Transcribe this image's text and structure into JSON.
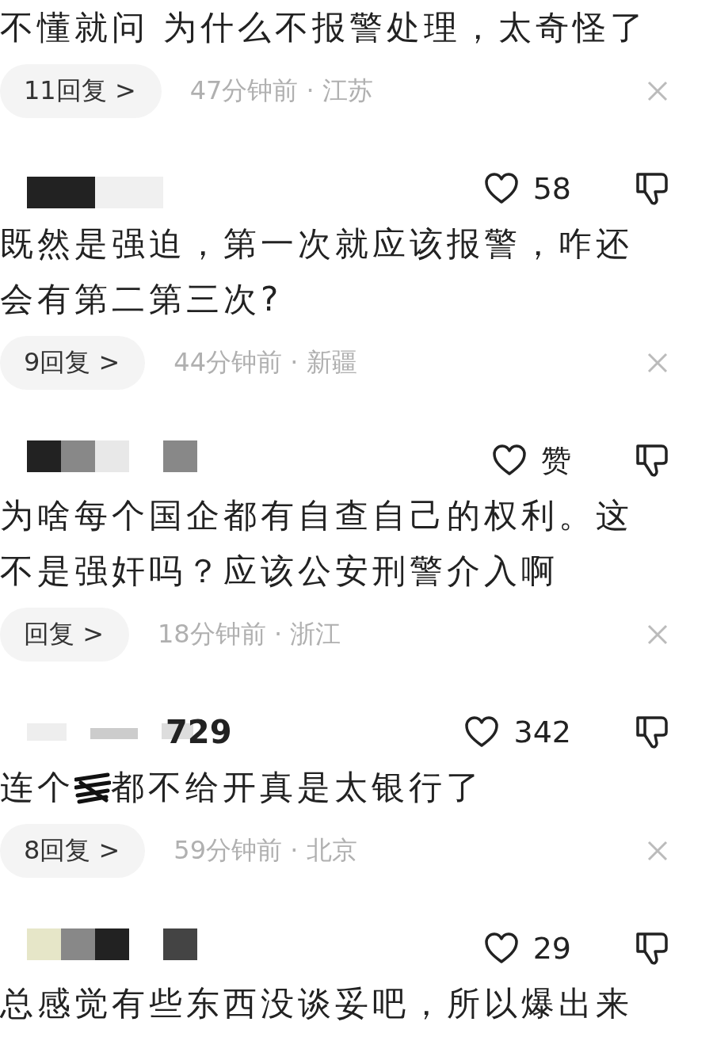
{
  "comments": [
    {
      "text": "不懂就问 为什么不报警处理，太奇怪了",
      "replies": "11回复 >",
      "meta": "47分钟前 · 江苏"
    },
    {
      "likes": "58",
      "text": "既然是强迫，第一次就应该报警，咋还会有第二第三次?",
      "replies": "9回复 >",
      "meta": "44分钟前 · 新疆"
    },
    {
      "likes": "赞",
      "text": "为啥每个国企都有自查自己的权利。这不是强奸吗？应该公安刑警介入啊",
      "replies": "回复 >",
      "meta": "18分钟前 · 浙江"
    },
    {
      "name": "729",
      "likes": "342",
      "text": "连个",
      "text_after": "都不给开真是太银行了",
      "replies": "8回复 >",
      "meta": "59分钟前 · 北京"
    },
    {
      "likes": "29",
      "text": "总感觉有些东西没谈妥吧，所以爆出来"
    }
  ]
}
